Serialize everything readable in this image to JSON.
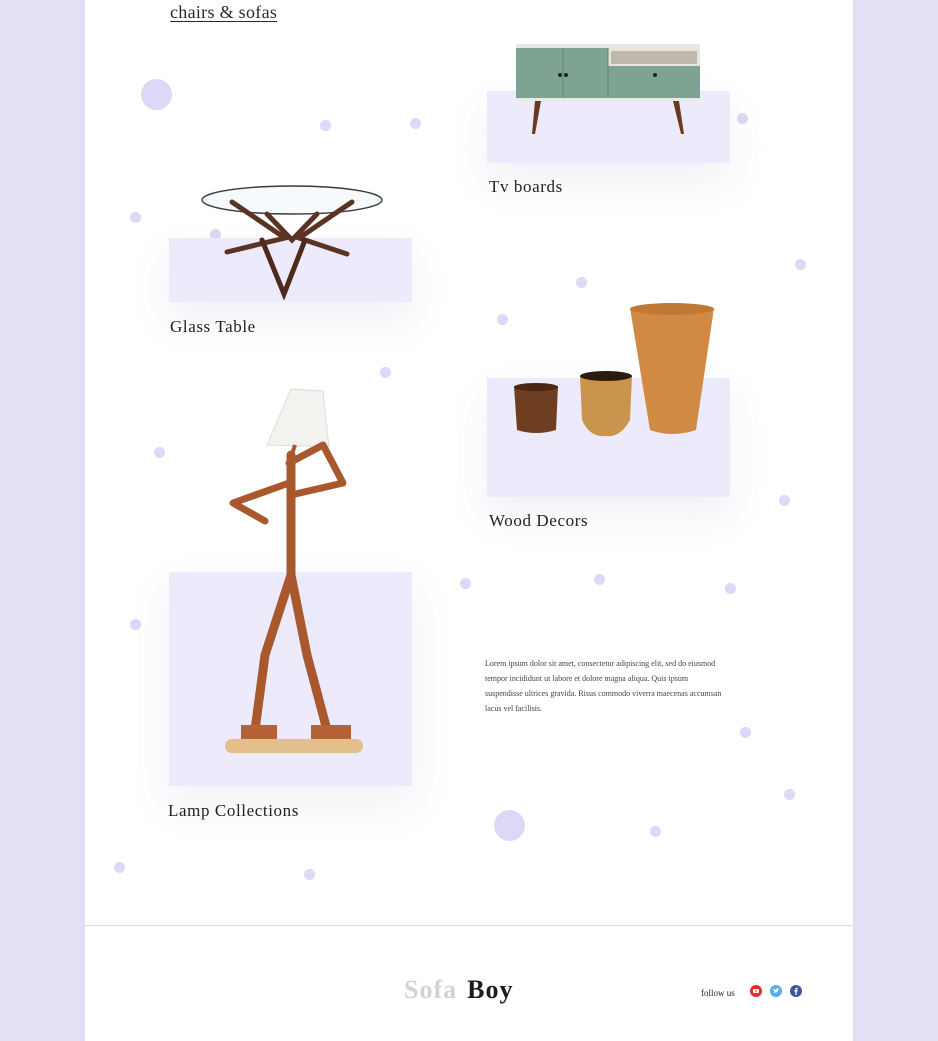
{
  "nav": {
    "category_link": "chairs & sofas"
  },
  "products": {
    "glass_table": "Glass Table",
    "tv_boards": "Tv boards",
    "lamp_collections": "Lamp Collections",
    "wood_decors": "Wood Decors"
  },
  "description": "Lorem ipsum dolor sit amet, consectetur adipiscing elit, sed do eiusmod tempor incididunt ut labore et dolore magna aliqua. Quis ipsum suspendisse ultrices gravida. Risus commodo viverra maecenas accumsan lacus vel facilisis.",
  "footer": {
    "logo_part1": "Sofa",
    "logo_part2": "Boy",
    "follow_label": "follow us",
    "social_icons": [
      "youtube-icon",
      "twitter-icon",
      "facebook-icon"
    ]
  },
  "colors": {
    "background": "#e3e0f6",
    "panel": "#edebfb",
    "dot": "#dcd8f6",
    "youtube": "#e52d27",
    "twitter": "#55acee",
    "facebook": "#3b5998"
  }
}
